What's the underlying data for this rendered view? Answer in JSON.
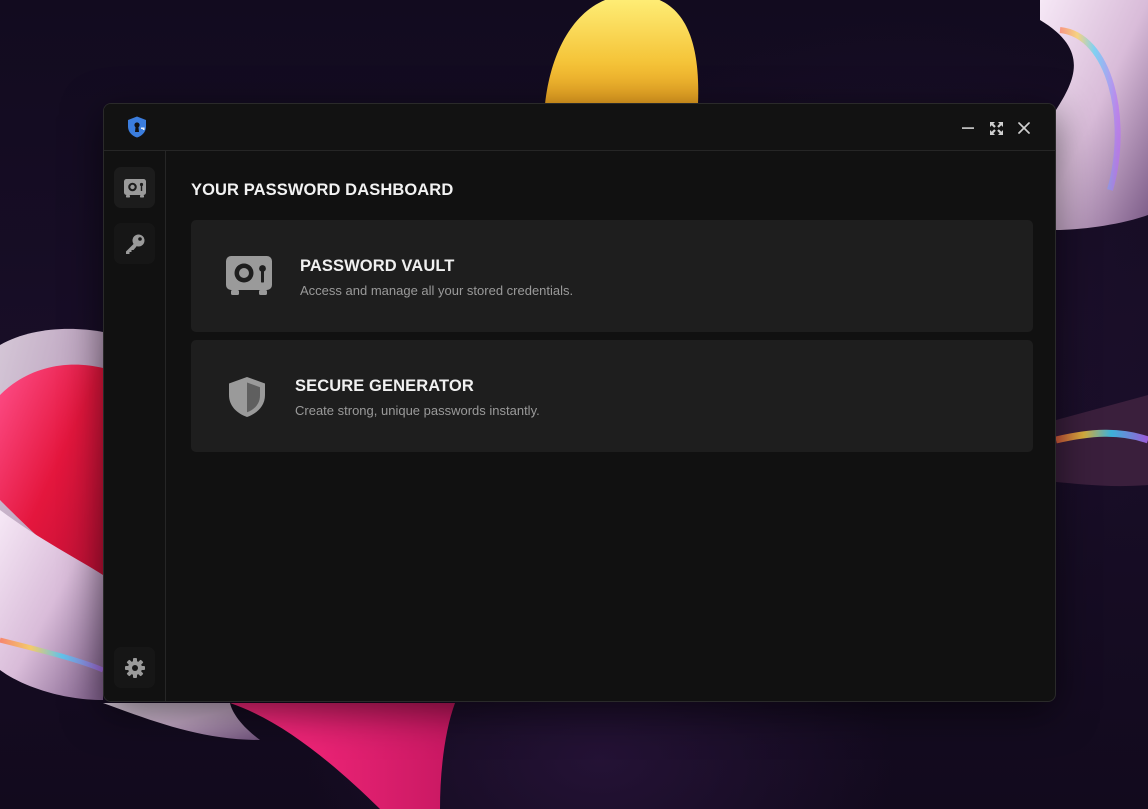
{
  "colors": {
    "window_bg": "#111111",
    "card_bg": "#1e1e1e",
    "accent_blue": "#3b7ddd",
    "icon_gray": "#9a9a9a",
    "title_text": "#f0f0f0",
    "desc_text": "#9a9a9a"
  },
  "titlebar": {
    "logo_icon": "shield-keyhole-icon",
    "controls": [
      {
        "name": "minimize-button",
        "icon": "minimize-icon"
      },
      {
        "name": "maximize-button",
        "icon": "maximize-icon"
      },
      {
        "name": "close-button",
        "icon": "close-icon"
      }
    ]
  },
  "sidebar": {
    "items": [
      {
        "name": "sidebar-item-vault",
        "icon": "vault-icon",
        "active": true
      },
      {
        "name": "sidebar-item-generator",
        "icon": "key-icon",
        "active": false
      }
    ],
    "settings": {
      "icon": "gear-icon"
    }
  },
  "main": {
    "title": "YOUR PASSWORD DASHBOARD",
    "cards": [
      {
        "icon": "vault-icon",
        "title": "PASSWORD VAULT",
        "description": "Access and manage all your stored credentials."
      },
      {
        "icon": "shield-icon",
        "title": "SECURE GENERATOR",
        "description": "Create strong, unique passwords instantly."
      }
    ]
  }
}
